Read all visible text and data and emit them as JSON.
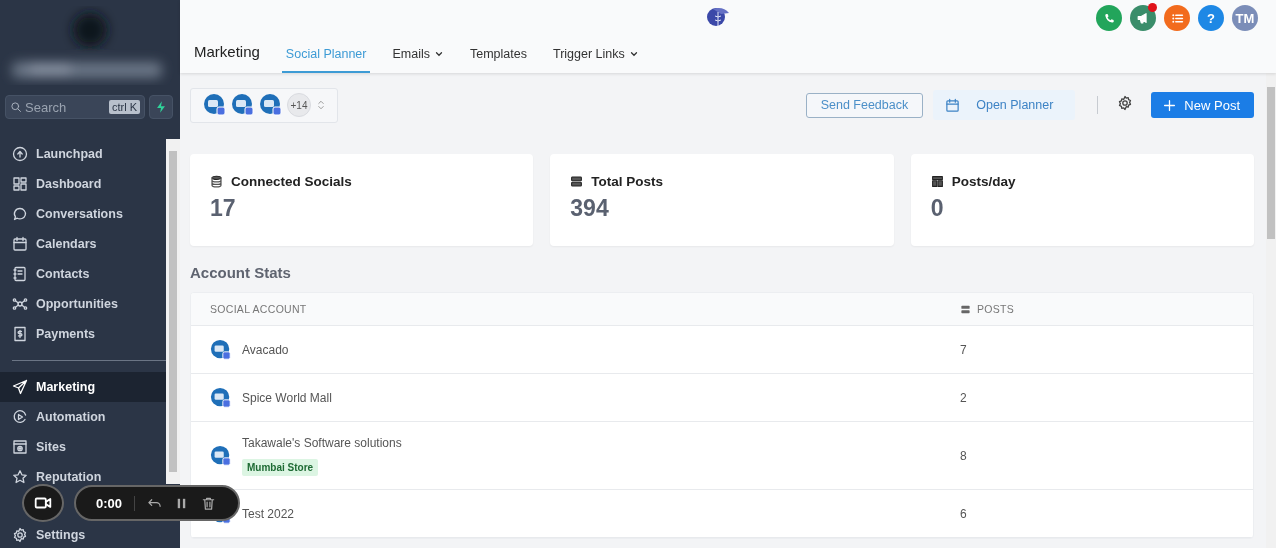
{
  "sidebar": {
    "search": {
      "placeholder": "Search",
      "shortcut": "ctrl K"
    },
    "items": [
      {
        "label": "Launchpad",
        "selected": false
      },
      {
        "label": "Dashboard",
        "selected": false
      },
      {
        "label": "Conversations",
        "selected": false
      },
      {
        "label": "Calendars",
        "selected": false
      },
      {
        "label": "Contacts",
        "selected": false
      },
      {
        "label": "Opportunities",
        "selected": false
      },
      {
        "label": "Payments",
        "selected": false
      },
      {
        "label": "Marketing",
        "selected": true
      },
      {
        "label": "Automation",
        "selected": false
      },
      {
        "label": "Sites",
        "selected": false
      },
      {
        "label": "Reputation",
        "selected": false
      }
    ],
    "footer_item": {
      "label": "Settings"
    }
  },
  "header": {
    "title": "Marketing",
    "tabs": [
      {
        "label": "Social Planner",
        "selected": true,
        "dropdown": false
      },
      {
        "label": "Emails",
        "selected": false,
        "dropdown": true
      },
      {
        "label": "Templates",
        "selected": false,
        "dropdown": false
      },
      {
        "label": "Trigger Links",
        "selected": false,
        "dropdown": true
      }
    ],
    "actions": [
      {
        "kind": "phone"
      },
      {
        "kind": "announcements",
        "unread": true
      },
      {
        "kind": "tasks"
      },
      {
        "kind": "help",
        "text": "?"
      },
      {
        "kind": "avatar",
        "text": "TM"
      }
    ]
  },
  "toolbar": {
    "accounts_more": "+14",
    "send_feedback": "Send Feedback",
    "open_planner": "Open Planner",
    "new_post": "New Post"
  },
  "stats": [
    {
      "title": "Connected Socials",
      "value": "17"
    },
    {
      "title": "Total Posts",
      "value": "394"
    },
    {
      "title": "Posts/day",
      "value": "0"
    }
  ],
  "account_stats": {
    "title": "Account Stats",
    "columns": [
      "SOCIAL ACCOUNT",
      "POSTS"
    ],
    "rows": [
      {
        "account": "Avacado",
        "posts": "7"
      },
      {
        "account": "Spice World Mall",
        "posts": "2"
      },
      {
        "account": "Takawale's Software solutions",
        "tag": "Mumbai Store",
        "posts": "8"
      },
      {
        "account": "Test 2022",
        "posts": "6"
      }
    ]
  },
  "recorder": {
    "time": "0:00"
  }
}
